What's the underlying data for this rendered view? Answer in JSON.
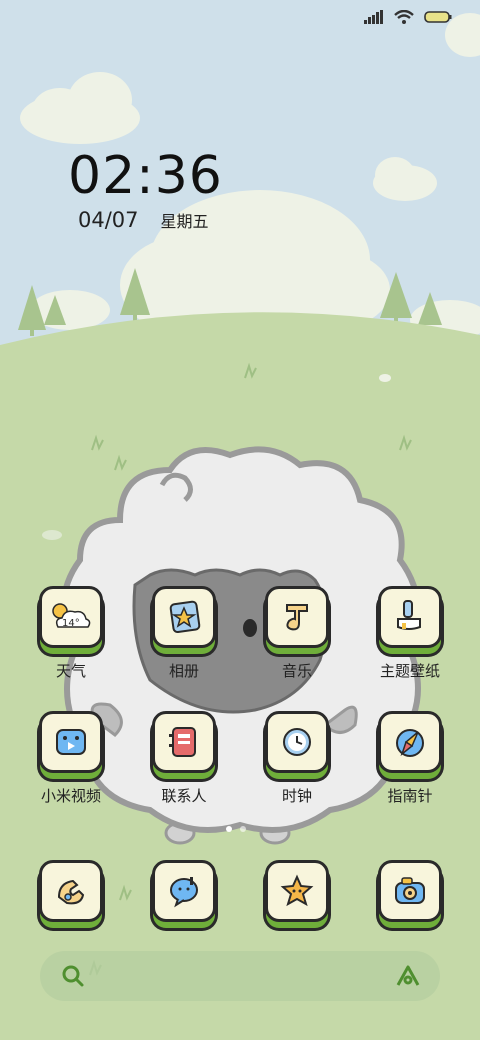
{
  "status_bar": {
    "icons": [
      "signal-icon",
      "wifi-icon",
      "battery-icon"
    ]
  },
  "clock": {
    "time": "02:36",
    "date": "04/07",
    "weekday": "星期五"
  },
  "apps": [
    {
      "label": "天气",
      "icon": "weather-icon",
      "temp": "14°"
    },
    {
      "label": "相册",
      "icon": "gallery-icon"
    },
    {
      "label": "音乐",
      "icon": "music-icon"
    },
    {
      "label": "主题壁纸",
      "icon": "themes-icon"
    },
    {
      "label": "小米视频",
      "icon": "video-icon"
    },
    {
      "label": "联系人",
      "icon": "contacts-icon"
    },
    {
      "label": "时钟",
      "icon": "clock-icon"
    },
    {
      "label": "指南针",
      "icon": "compass-icon"
    }
  ],
  "dock": [
    {
      "icon": "phone-icon"
    },
    {
      "icon": "messages-icon"
    },
    {
      "icon": "star-app-icon"
    },
    {
      "icon": "camera-icon"
    }
  ],
  "search_bar": {
    "left_icon": "search-icon",
    "right_icon": "assistant-icon"
  },
  "colors": {
    "sky": "#cfe0ea",
    "hill": "#c5d9a8",
    "tile_bg": "#f8f5dc",
    "tile_base": "#6fae3a",
    "outline": "#2a2a2a"
  }
}
